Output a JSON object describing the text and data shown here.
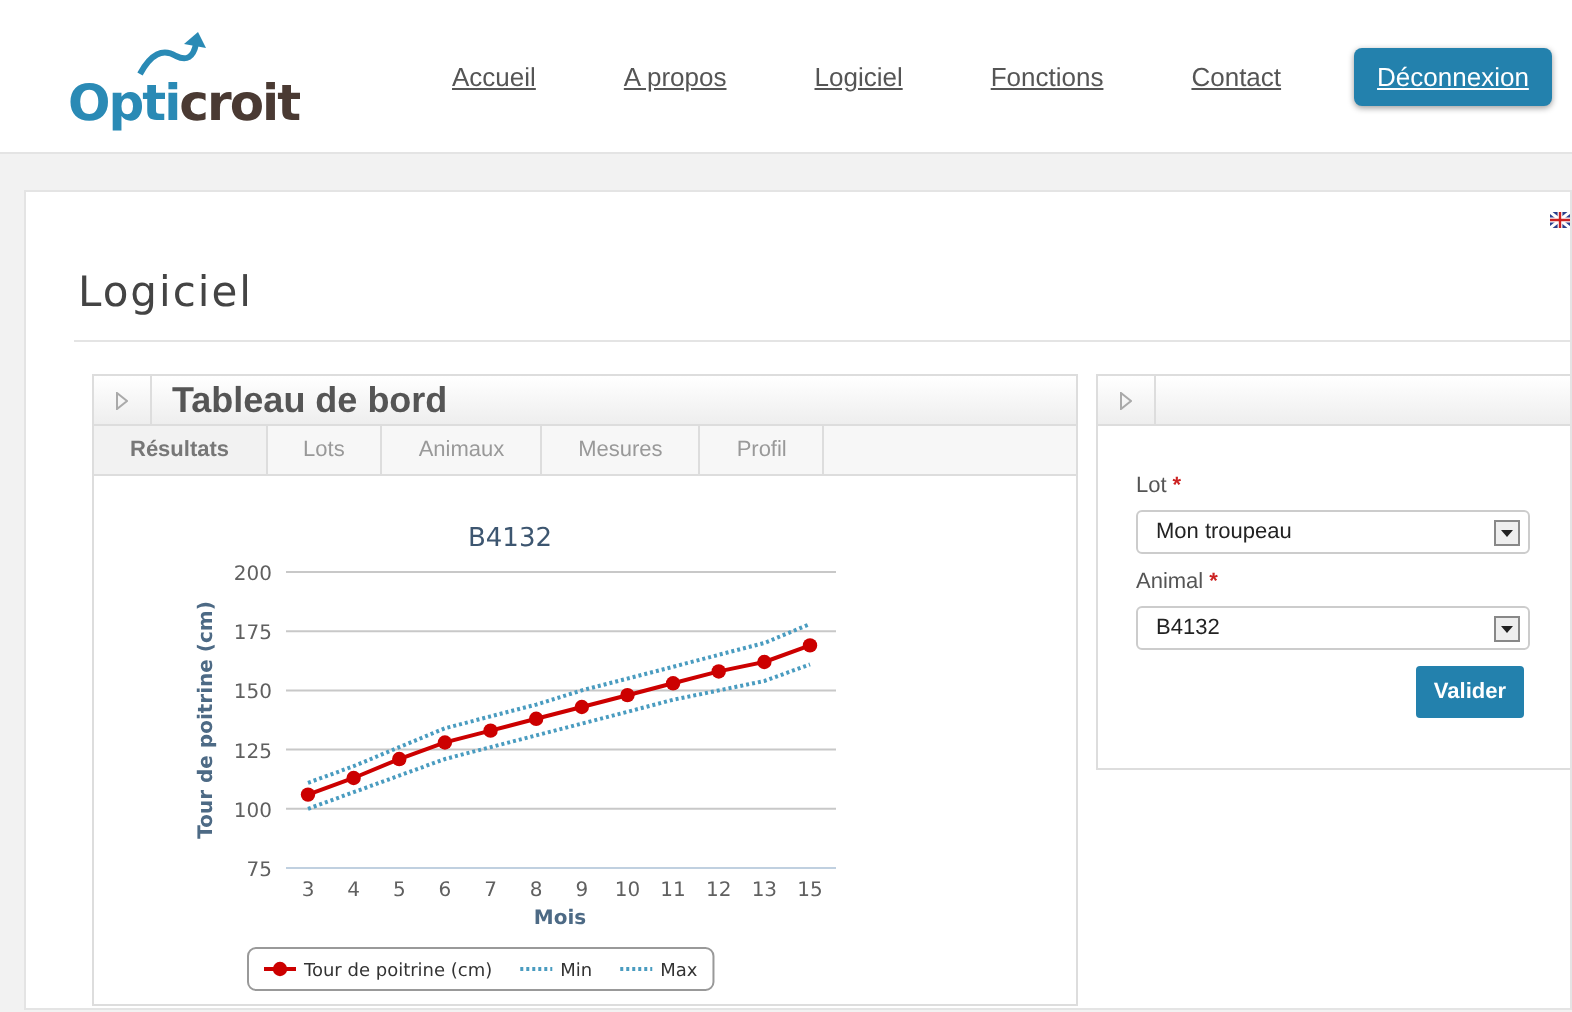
{
  "header": {
    "logo": {
      "part_1": "Opti",
      "part_2": "croit"
    },
    "nav": [
      {
        "label": "Accueil",
        "kind": "link"
      },
      {
        "label": "A propos",
        "kind": "link"
      },
      {
        "label": "Logiciel",
        "kind": "link"
      },
      {
        "label": "Fonctions",
        "kind": "link"
      },
      {
        "label": "Contact",
        "kind": "link"
      },
      {
        "label": "Déconnexion",
        "kind": "button"
      }
    ]
  },
  "page_title": "Logiciel",
  "dashboard": {
    "title": "Tableau de bord",
    "tabs": [
      {
        "label": "Résultats",
        "selected": true
      },
      {
        "label": "Lots",
        "selected": false
      },
      {
        "label": "Animaux",
        "selected": false
      },
      {
        "label": "Mesures",
        "selected": false
      },
      {
        "label": "Profil",
        "selected": false
      }
    ],
    "chart_data": {
      "type": "line",
      "grid": true,
      "legend": true,
      "title": "B4132",
      "xlabel": "Mois",
      "ylabel": "Tour de poitrine (cm)",
      "categories": [
        "3",
        "4",
        "5",
        "6",
        "7",
        "8",
        "9",
        "10",
        "11",
        "12",
        "13",
        "15"
      ],
      "ylim": [
        75,
        200
      ],
      "yticks": [
        75,
        100,
        125,
        150,
        175,
        200
      ],
      "series": [
        {
          "name": "Tour de poitrine (cm)",
          "color": "#cc0000",
          "marker": "circle",
          "line_style": "solid",
          "values": [
            106,
            113,
            121,
            128,
            133,
            138,
            143,
            148,
            153,
            158,
            162,
            169
          ]
        },
        {
          "name": "Min",
          "color": "#4a9cc0",
          "line_style": "dotted",
          "values": [
            100,
            107,
            114,
            121,
            126,
            131,
            136,
            141,
            146,
            150,
            154,
            161
          ]
        },
        {
          "name": "Max",
          "color": "#4a9cc0",
          "line_style": "dotted",
          "values": [
            111,
            118,
            126,
            134,
            139,
            144,
            150,
            155,
            160,
            165,
            170,
            178
          ]
        }
      ]
    }
  },
  "form": {
    "fields": [
      {
        "label": "Lot",
        "required_mark": "*",
        "value": "Mon troupeau"
      },
      {
        "label": "Animal",
        "required_mark": "*",
        "value": "B4132"
      }
    ],
    "submit": "Valider"
  }
}
